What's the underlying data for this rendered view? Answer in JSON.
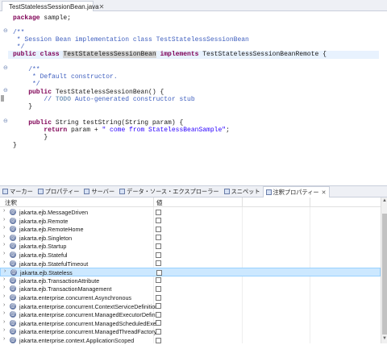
{
  "editor": {
    "tab_title": "TestStatelessSessionBean.java",
    "tab_close": "✕",
    "fold_minus": "⊖",
    "lines": {
      "l1_kw": "package",
      "l1_rest": " sample;",
      "l3": "/**",
      "l4": " * Session Bean implementation class TestStatelessSessionBean",
      "l5": " */",
      "l6_kw1": "public class",
      "l6_sp": " ",
      "l6_name": "TestStatelessSessionBean",
      "l6_kw2": " implements",
      "l6_rest": " TestStatelessSessionBeanRemote {",
      "l8": "    /**",
      "l9": "     * Default constructor.",
      "l10": "     */",
      "l11_kw": "    public",
      "l11_rest": " TestStatelessSessionBean() {",
      "l12_cm": "        // ",
      "l12_todo": "TODO",
      "l12_cm2": " Auto-generated constructor stub",
      "l13": "    }",
      "l15_kw": "    public",
      "l15_rest": " String testString(String param) {",
      "l16_kw": "        return",
      "l16_rest": " param + ",
      "l16_str": "\" come from StatelessBeanSample\"",
      "l16_end": ";",
      "l17": "        }",
      "l18": "}"
    }
  },
  "views": {
    "tabs": [
      {
        "label": "マーカー"
      },
      {
        "label": "プロパティー"
      },
      {
        "label": "サーバー"
      },
      {
        "label": "データ・ソース・エクスプローラー"
      },
      {
        "label": "スニペット"
      },
      {
        "label": "注釈プロパティー",
        "close": "✕"
      }
    ]
  },
  "annotations": {
    "col_annotation": "注釈",
    "col_value": "値",
    "chevron": "›",
    "ann_glyph": "@",
    "rows": [
      {
        "name": "jakarta.ejb.MessageDriven"
      },
      {
        "name": "jakarta.ejb.Remote"
      },
      {
        "name": "jakarta.ejb.RemoteHome"
      },
      {
        "name": "jakarta.ejb.Singleton"
      },
      {
        "name": "jakarta.ejb.Startup"
      },
      {
        "name": "jakarta.ejb.Stateful"
      },
      {
        "name": "jakarta.ejb.StatefulTimeout"
      },
      {
        "name": "jakarta.ejb.Stateless",
        "selected": true
      },
      {
        "name": "jakarta.ejb.TransactionAttribute"
      },
      {
        "name": "jakarta.ejb.TransactionManagement"
      },
      {
        "name": "jakarta.enterprise.concurrent.Asynchronous"
      },
      {
        "name": "jakarta.enterprise.concurrent.ContextServiceDefinition"
      },
      {
        "name": "jakarta.enterprise.concurrent.ManagedExecutorDefinit"
      },
      {
        "name": "jakarta.enterprise.concurrent.ManagedScheduledExecu"
      },
      {
        "name": "jakarta.enterprise.concurrent.ManagedThreadFactoryD"
      },
      {
        "name": "jakarta.enterprise.context.ApplicationScoped"
      }
    ]
  },
  "scrollbar": {
    "up": "▲",
    "down": "▼"
  }
}
